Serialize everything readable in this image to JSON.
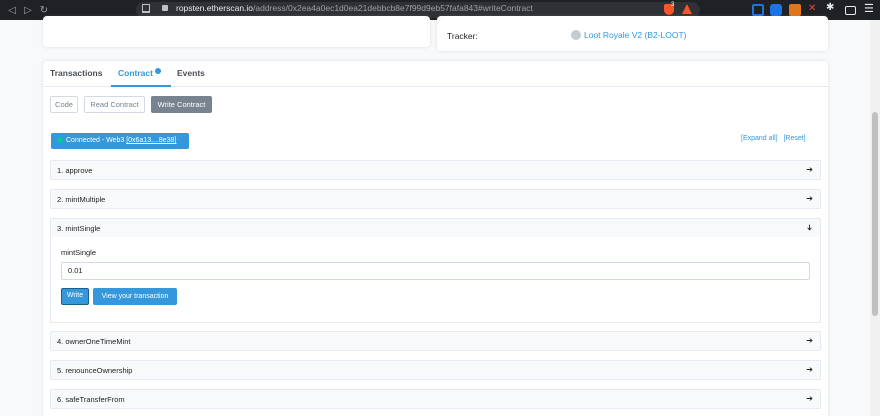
{
  "browser": {
    "url_host": "ropsten.etherscan.io",
    "url_path": "/address/0x2ea4a0ec1d0ea21debbcb8e7f99d9eb57fafa843#writeContract",
    "brave_badge": "3"
  },
  "overview": {
    "tracker_label": "Tracker:",
    "token_name": "Loot Royale V2 (B2-LOOT)"
  },
  "tabs": [
    {
      "label": "Transactions"
    },
    {
      "label": "Contract"
    },
    {
      "label": "Events"
    }
  ],
  "sub_tabs": {
    "code": "Code",
    "read": "Read Contract",
    "write": "Write Contract"
  },
  "connection": {
    "status": "Connected - Web3 ",
    "address": "[0x6a13....8e38]"
  },
  "actions": {
    "expand_all": "[Expand all]",
    "reset": "[Reset]"
  },
  "functions": [
    {
      "name": "1. approve",
      "arrow": "➔"
    },
    {
      "name": "2. mintMultiple",
      "arrow": "➔"
    },
    {
      "name": "3. mintSingle",
      "arrow": "➔"
    },
    {
      "name": "4. ownerOneTimeMint",
      "arrow": "➔"
    },
    {
      "name": "5. renounceOwnership",
      "arrow": "➔"
    },
    {
      "name": "6. safeTransferFrom",
      "arrow": "➔"
    }
  ],
  "expanded": {
    "param_label": "mintSingle",
    "param_value": "0.01",
    "write_label": "Write",
    "view_label": "View your transaction"
  },
  "colors": {
    "accent": "#3498db",
    "muted": "#77838f",
    "success": "#00c9a7"
  }
}
